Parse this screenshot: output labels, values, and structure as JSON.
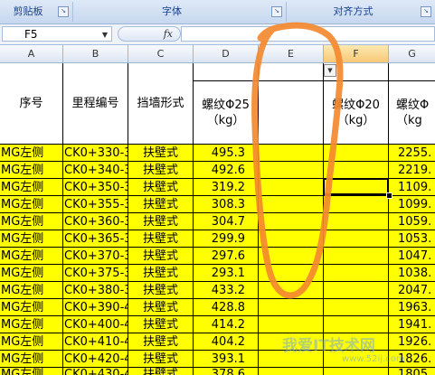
{
  "ribbon": {
    "groups": [
      {
        "label": "剪贴板"
      },
      {
        "label": "字体"
      },
      {
        "label": "对齐方式"
      }
    ]
  },
  "formula_bar": {
    "name_box": "F5",
    "fx_label": "fx",
    "value": ""
  },
  "columns": [
    "A",
    "B",
    "C",
    "D",
    "E",
    "F",
    "G"
  ],
  "header_row": {
    "a": "序号",
    "b": "里程编号",
    "c": "挡墙形式",
    "d_line1": "螺纹Φ25",
    "d_line2": "（kg）",
    "f_line1": "螺纹Φ20",
    "f_line2": "（kg）",
    "g_line1": "螺纹Φ",
    "g_line2": "（kg"
  },
  "rows": [
    {
      "a": "MG左侧",
      "b": "CK0+330-3",
      "c": "扶壁式",
      "d": "495.3",
      "g": "2255."
    },
    {
      "a": "MG左侧",
      "b": "CK0+340-3",
      "c": "扶壁式",
      "d": "492.6",
      "g": "2219."
    },
    {
      "a": "MG左侧",
      "b": "CK0+350-3",
      "c": "扶壁式",
      "d": "319.2",
      "g": "1109."
    },
    {
      "a": "MG左侧",
      "b": "CK0+355-3",
      "c": "扶壁式",
      "d": "308.3",
      "g": "1099."
    },
    {
      "a": "MG左侧",
      "b": "CK0+360-3",
      "c": "扶壁式",
      "d": "304.7",
      "g": "1059."
    },
    {
      "a": "MG左侧",
      "b": "CK0+365-3",
      "c": "扶壁式",
      "d": "299.9",
      "g": "1053."
    },
    {
      "a": "MG左侧",
      "b": "CK0+370-3",
      "c": "扶壁式",
      "d": "297.6",
      "g": "1047."
    },
    {
      "a": "MG左侧",
      "b": "CK0+375-3",
      "c": "扶壁式",
      "d": "293.1",
      "g": "1038."
    },
    {
      "a": "MG左侧",
      "b": "CK0+380-3",
      "c": "扶壁式",
      "d": "433.2",
      "g": "2047."
    },
    {
      "a": "MG左侧",
      "b": "CK0+390-4",
      "c": "扶壁式",
      "d": "428.8",
      "g": "1963."
    },
    {
      "a": "MG左侧",
      "b": "CK0+400-4",
      "c": "扶壁式",
      "d": "414.2",
      "g": "1941."
    },
    {
      "a": "MG左侧",
      "b": "CK0+410-4",
      "c": "扶壁式",
      "d": "404.2",
      "g": "1926."
    },
    {
      "a": "MG左侧",
      "b": "CK0+420-4",
      "c": "扶壁式",
      "d": "393.1",
      "g": "1826."
    },
    {
      "a": "MG左侧",
      "b": "CK0+430-4",
      "c": "扶壁式",
      "d": "378.6",
      "g": "1805."
    }
  ],
  "watermark": {
    "text": "我爱IT技术网",
    "url": "www.52ij.com"
  },
  "colors": {
    "highlight": "#ffff00",
    "ink": "#f4892f",
    "ribbon": "#c6d7ef"
  }
}
